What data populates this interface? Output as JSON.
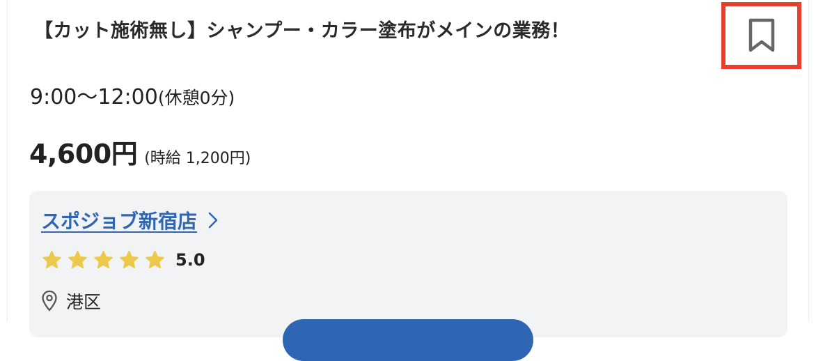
{
  "job": {
    "title": "【カット施術無し】シャンプー・カラー塗布がメインの業務！",
    "time": "9:00〜12:00",
    "break": "(休憩0分)",
    "amount": "4,600円",
    "hourly": "(時給 1,200円)"
  },
  "shop": {
    "name": "スポジョブ新宿店",
    "rating_stars": 5,
    "rating": "5.0",
    "area": "港区"
  },
  "icons": {
    "bookmark": "bookmark-icon",
    "chevron": "chevron-right-icon",
    "star": "star-icon",
    "location": "map-pin-icon"
  },
  "colors": {
    "accent": "#2f66b3",
    "highlight_border": "#e8402c",
    "star": "#ecc94b",
    "panel": "#f2f3f5"
  }
}
